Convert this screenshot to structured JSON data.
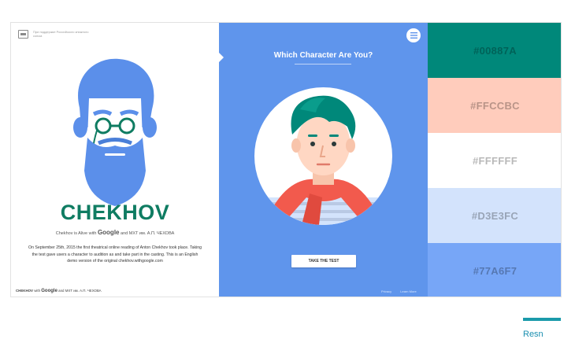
{
  "left_panel": {
    "support_text": "При поддержке Российского книжного союза",
    "title": "CHEKHOV",
    "subtitle_before": "Chekhov is Alive with",
    "subtitle_brand": "Google",
    "subtitle_after": "and МХТ им. А.П. ЧЕХОВА",
    "description": "On September 25th, 2015 the first theatrical online reading of Anton Chekhov took place. Taking the test gave users a character to audition as and take part in the casting. This is an English demo version of the original chekhov.withgoogle.com",
    "footer_brand": "CHEKHOV",
    "footer_with": "with",
    "footer_google": "Google",
    "footer_after": "and МХТ им. А.П. ЧЕХОВА"
  },
  "mid_panel": {
    "question": "Which Character Are You?",
    "cta": "TAKE THE TEST",
    "footer_links": [
      "Privacy",
      "Learn More"
    ]
  },
  "palette": [
    {
      "label": "#00887A",
      "color": "#00887A"
    },
    {
      "label": "#FFCCBC",
      "color": "#FFCCBC"
    },
    {
      "label": "#FFFFFF",
      "color": "#FFFFFF"
    },
    {
      "label": "#D3E3FC",
      "color": "#D3E3FC"
    },
    {
      "label": "#77A6F7",
      "color": "#77A6F7"
    }
  ],
  "page_footer": {
    "label": "Resn"
  },
  "icons": {
    "menu": "menu-icon",
    "support_logo": "book-union-logo-icon"
  }
}
